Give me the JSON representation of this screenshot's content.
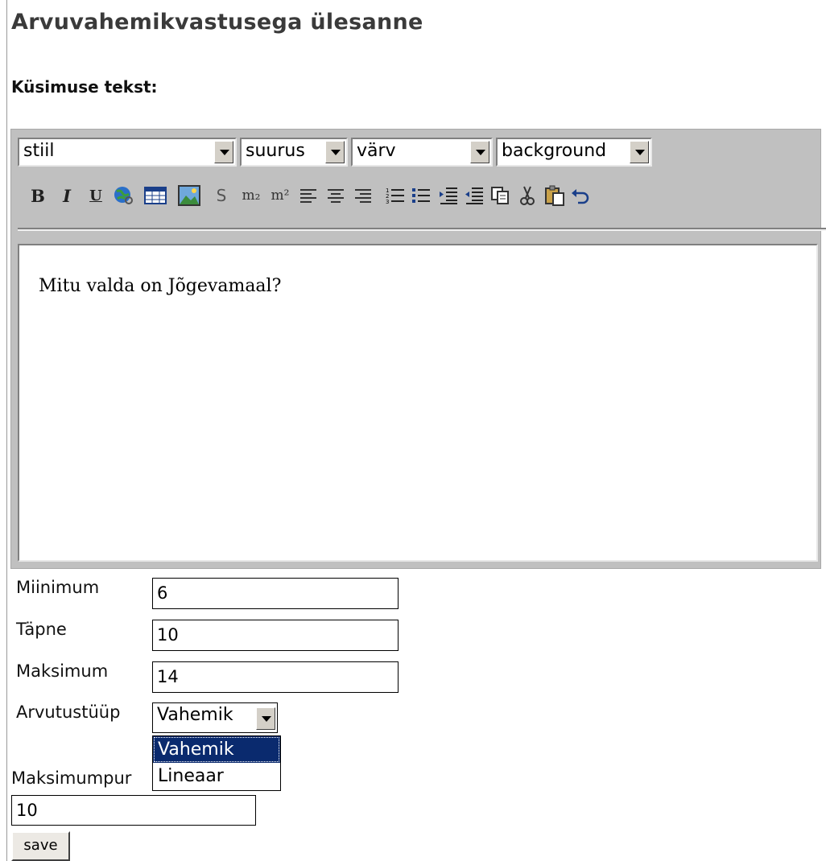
{
  "page": {
    "title": "Arvuvahemikvastusega ülesanne",
    "question_label": "Küsimuse tekst:"
  },
  "editor": {
    "style_select": "stiil",
    "size_select": "suurus",
    "color_select": "värv",
    "background_select": "background",
    "toolbar": {
      "bold": "B",
      "italic": "I",
      "underline": "U",
      "strike": "S",
      "subscript": "m₂",
      "superscript": "m²"
    },
    "content": "Mitu valda on Jõgevamaal?"
  },
  "fields": {
    "minimum": {
      "label": "Miinimum",
      "value": "6"
    },
    "exact": {
      "label": "Täpne",
      "value": "10"
    },
    "maximum": {
      "label": "Maksimum",
      "value": "14"
    },
    "calc_type": {
      "label": "Arvutustüüp",
      "value": "Vahemik",
      "options": [
        "Vahemik",
        "Lineaar"
      ]
    },
    "max_points": {
      "label": "Maksimumpunktid",
      "label_visible": "Maksimumpur",
      "value": "10"
    }
  },
  "buttons": {
    "save": "save"
  },
  "colors": {
    "toolbar_bg": "#c0c0c0",
    "selected_option": "#0a2a6e",
    "title": "#3a3a3a"
  }
}
